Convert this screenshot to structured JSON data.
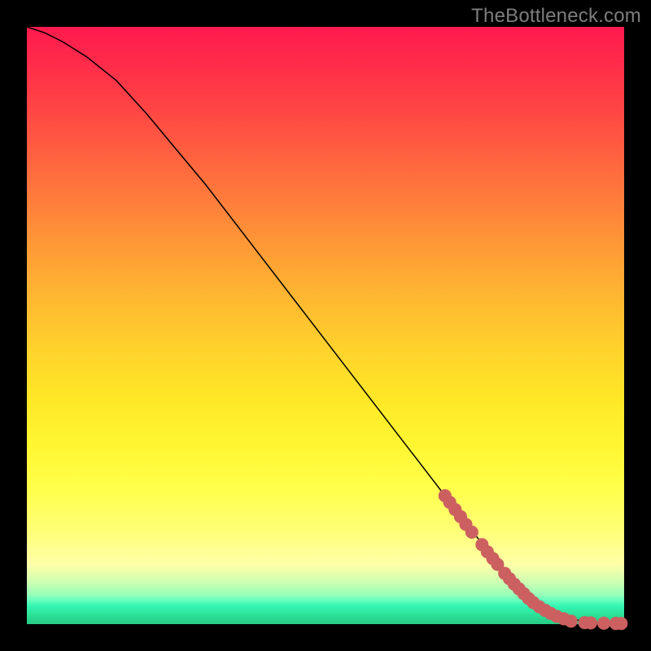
{
  "watermark": "TheBottleneck.com",
  "colors": {
    "dot": "#cc6060",
    "curve": "#000000",
    "frame": "#000000"
  },
  "chart_data": {
    "type": "line",
    "title": "",
    "xlabel": "",
    "ylabel": "",
    "xlim": [
      0,
      100
    ],
    "ylim": [
      0,
      100
    ],
    "series": [
      {
        "name": "curve",
        "x": [
          0,
          3,
          6,
          10,
          15,
          20,
          25,
          30,
          35,
          40,
          45,
          50,
          55,
          60,
          65,
          70,
          75,
          80,
          83,
          86,
          89,
          92,
          95,
          98,
          100
        ],
        "y": [
          100,
          99,
          97.5,
          95,
          91,
          85.5,
          79.5,
          73.5,
          67,
          60.5,
          54,
          47.5,
          41,
          34.5,
          28,
          21.5,
          15,
          9,
          5.5,
          3,
          1.5,
          0.7,
          0.3,
          0.1,
          0.1
        ]
      }
    ],
    "points": [
      {
        "name": "cluster-a",
        "x": 70.0,
        "y": 21.5
      },
      {
        "name": "cluster-a",
        "x": 70.8,
        "y": 20.4
      },
      {
        "name": "cluster-a",
        "x": 71.7,
        "y": 19.2
      },
      {
        "name": "cluster-a",
        "x": 72.6,
        "y": 18.0
      },
      {
        "name": "cluster-a",
        "x": 73.5,
        "y": 16.7
      },
      {
        "name": "cluster-a",
        "x": 74.5,
        "y": 15.4
      },
      {
        "name": "cluster-b",
        "x": 76.2,
        "y": 13.3
      },
      {
        "name": "cluster-b",
        "x": 77.1,
        "y": 12.1
      },
      {
        "name": "cluster-b",
        "x": 78.0,
        "y": 11.0
      },
      {
        "name": "cluster-b",
        "x": 78.8,
        "y": 10.0
      },
      {
        "name": "cluster-c",
        "x": 80.0,
        "y": 8.5
      },
      {
        "name": "cluster-c",
        "x": 80.8,
        "y": 7.6
      },
      {
        "name": "cluster-c",
        "x": 81.6,
        "y": 6.7
      },
      {
        "name": "cluster-c",
        "x": 82.4,
        "y": 5.9
      },
      {
        "name": "cluster-c",
        "x": 83.2,
        "y": 5.1
      },
      {
        "name": "cluster-c",
        "x": 84.0,
        "y": 4.3
      },
      {
        "name": "cluster-c",
        "x": 84.8,
        "y": 3.6
      },
      {
        "name": "cluster-d",
        "x": 85.8,
        "y": 2.9
      },
      {
        "name": "cluster-d",
        "x": 86.8,
        "y": 2.3
      },
      {
        "name": "cluster-d",
        "x": 87.7,
        "y": 1.8
      },
      {
        "name": "cluster-d",
        "x": 88.7,
        "y": 1.3
      },
      {
        "name": "cluster-d",
        "x": 89.9,
        "y": 0.9
      },
      {
        "name": "cluster-d",
        "x": 91.1,
        "y": 0.5
      },
      {
        "name": "tail",
        "x": 93.4,
        "y": 0.25
      },
      {
        "name": "tail",
        "x": 94.4,
        "y": 0.22
      },
      {
        "name": "tail",
        "x": 96.6,
        "y": 0.16
      },
      {
        "name": "tail",
        "x": 98.6,
        "y": 0.12
      },
      {
        "name": "tail",
        "x": 99.5,
        "y": 0.11
      }
    ],
    "dot_radius_units": 1.1
  }
}
